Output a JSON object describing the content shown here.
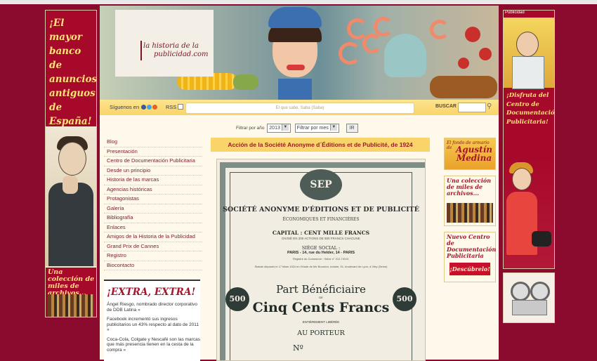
{
  "site": {
    "logo_line1": "la historia de la",
    "logo_line2": "publicidad.com"
  },
  "left_ad": {
    "slogan_lines": [
      "¡El mayor",
      "banco de",
      "anuncios",
      "antiguos",
      "de",
      "España!"
    ],
    "bottom_text": "Una colección de miles de archivos..."
  },
  "right_ad": {
    "tag": "Publicidad",
    "slogan_lines": [
      "¡Disfruta del",
      "Centro de",
      "Documentación",
      "Publicitaria!"
    ]
  },
  "follow_bar": {
    "follow_label": "Síguenos en",
    "social_icons": [
      {
        "name": "facebook-icon",
        "color": "#3b5998"
      },
      {
        "name": "twitter-icon",
        "color": "#4aa3df"
      },
      {
        "name": "share-icon",
        "color": "#e0632a"
      }
    ],
    "rss_label": "RSS",
    "quote": "El que sabe, Saba (Saba)",
    "search_label": "BUSCAR",
    "search_value": ""
  },
  "filters": {
    "year_label": "Filtrar por año",
    "year_value": "2013",
    "month_value": "Filtrar por mes",
    "submit_label": "IR"
  },
  "nav": {
    "items": [
      "Blog",
      "Presentación",
      "Centro de Documentación Publicitaria",
      "Desde un principio",
      "Historia de las marcas",
      "Agencias históricas",
      "Protagonistas",
      "Galería",
      "Bibliografía",
      "Enlaces",
      "Amigos de la Historia de la Publicidad",
      "Grand Prix de Cannes",
      "Registro",
      "Biocontacto"
    ]
  },
  "extra": {
    "title": "¡EXTRA, EXTRA!",
    "news": [
      "Ángel Riesgo, nombrado director corporativo de DDB Latina »",
      "Facebook incrementó sus ingresos publicitarios un 43% respecto al dato de 2011 »",
      "Coca-Cola, Colgate y Nescafé son las marcas que más presencia tienen en la cesta de la compra »"
    ]
  },
  "article": {
    "title": "Acción de la Société Anonyme d´Éditions et de Publicité, de 1924"
  },
  "certificate": {
    "emblem": "SEP",
    "company": "SOCIÉTÉ ANONYME D'ÉDITIONS ET DE PUBLICITÉ",
    "subtitle": "ÉCONOMIQUES ET FINANCIÈRES",
    "capital": "CAPITAL : CENT MILLE FRANCS",
    "capital_detail": "DIVISÉ EN 200 ACTIONS DE 500 FRANCS CHACUNE",
    "seat_label": "SIÈGE SOCIAL :",
    "address": "PARIS - 14, rue du Helder, 14 - PARIS",
    "registry": "Registre du Commerce : Seine n° 212.743 B.",
    "statutes": "Statuts déposés le 17 Mars 1924 en l'étude de Me Bourdon, notaire, 51, boulevard de Lyon, à Vitry (Seine)",
    "denomination": "500",
    "part": "Part Bénéficiaire",
    "de": "DE",
    "amount": "Cinq Cents Francs",
    "liberated": "ENTIÈREMENT LIBÉRÉE",
    "bearer": "AU PORTEUR",
    "number_label": "Nº"
  },
  "right_col": {
    "box1_small": "El fondo de armario de",
    "box1_big": "Agustín Medina",
    "box2_text": "Una colección de miles de archivos...",
    "box3_text": "Nuevo Centro de Documentación Publicitaria",
    "box3_button": "¡Descúbrelo!"
  }
}
